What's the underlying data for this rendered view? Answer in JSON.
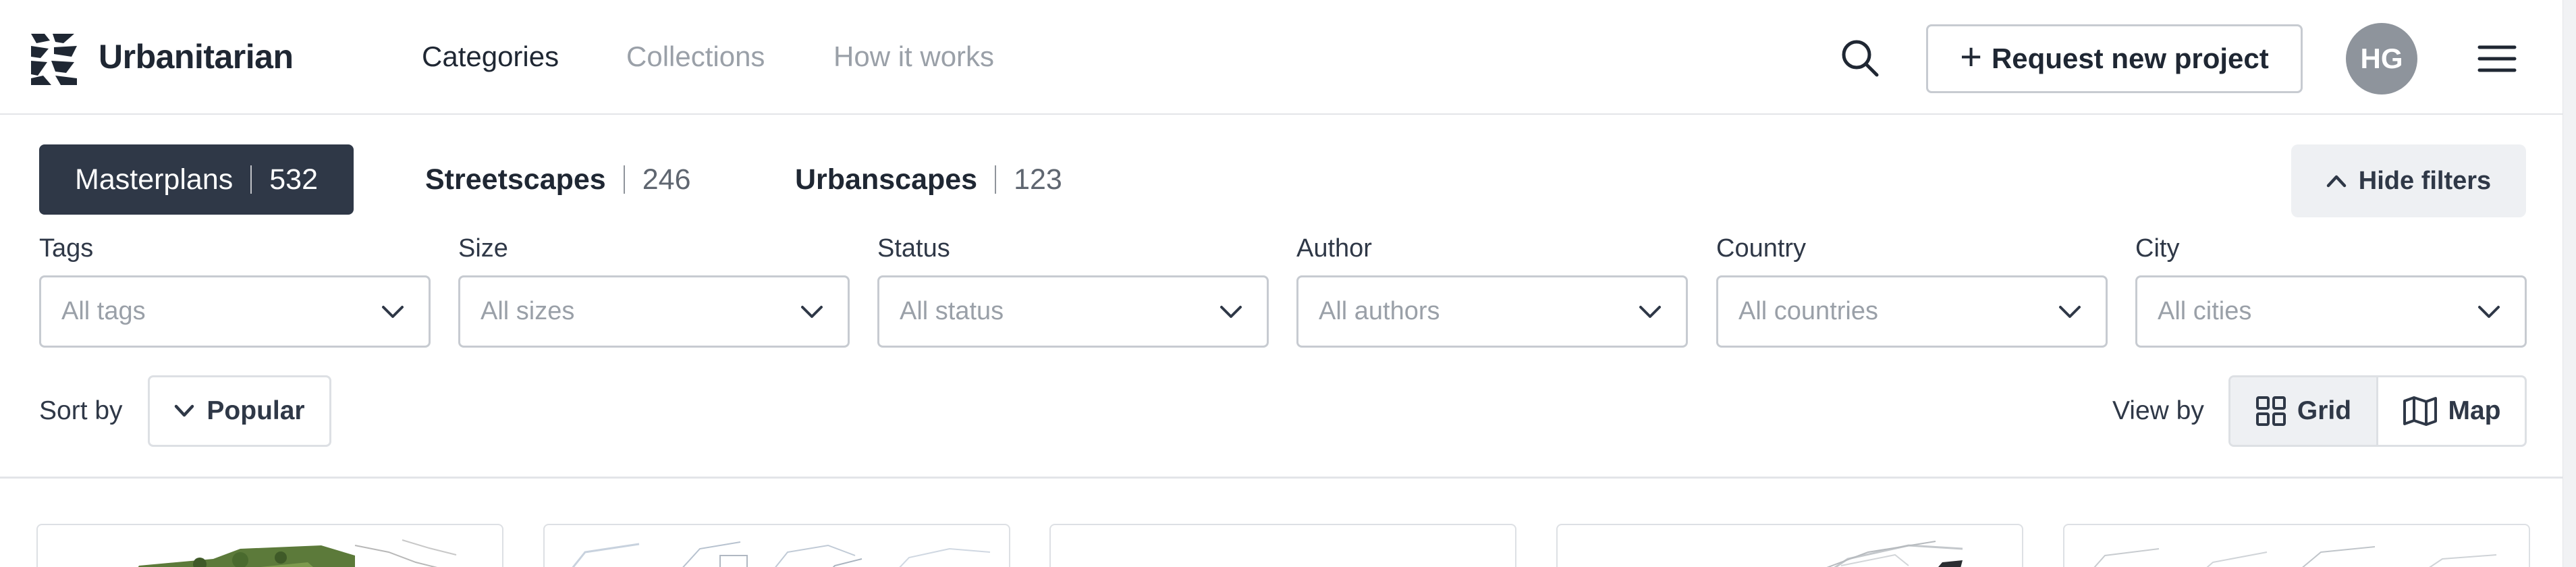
{
  "header": {
    "brand": "Urbanitarian",
    "nav": [
      "Categories",
      "Collections",
      "How it works"
    ],
    "request_button": "Request new project",
    "avatar_initials": "HG"
  },
  "tabs": [
    {
      "label": "Masterplans",
      "count": "532",
      "active": true
    },
    {
      "label": "Streetscapes",
      "count": "246",
      "active": false
    },
    {
      "label": "Urbanscapes",
      "count": "123",
      "active": false
    }
  ],
  "hide_filters": "Hide filters",
  "filters": [
    {
      "label": "Tags",
      "placeholder": "All tags"
    },
    {
      "label": "Size",
      "placeholder": "All sizes"
    },
    {
      "label": "Status",
      "placeholder": "All status"
    },
    {
      "label": "Author",
      "placeholder": "All authors"
    },
    {
      "label": "Country",
      "placeholder": "All countries"
    },
    {
      "label": "City",
      "placeholder": "All cities"
    }
  ],
  "sort": {
    "label": "Sort by",
    "value": "Popular"
  },
  "view": {
    "label": "View by",
    "options": [
      "Grid",
      "Map"
    ],
    "selected": "Grid"
  },
  "colors": {
    "primary_dark": "#2f3847",
    "muted_text": "#9aa0a8",
    "border": "#c7cbd1",
    "light_bg": "#eef0f3",
    "avatar_bg": "#8e949c"
  },
  "icons": [
    "brand-logo-icon",
    "search-icon",
    "plus-icon",
    "hamburger-menu-icon",
    "chevron-up-icon",
    "chevron-down-icon",
    "grid-icon",
    "map-icon"
  ]
}
